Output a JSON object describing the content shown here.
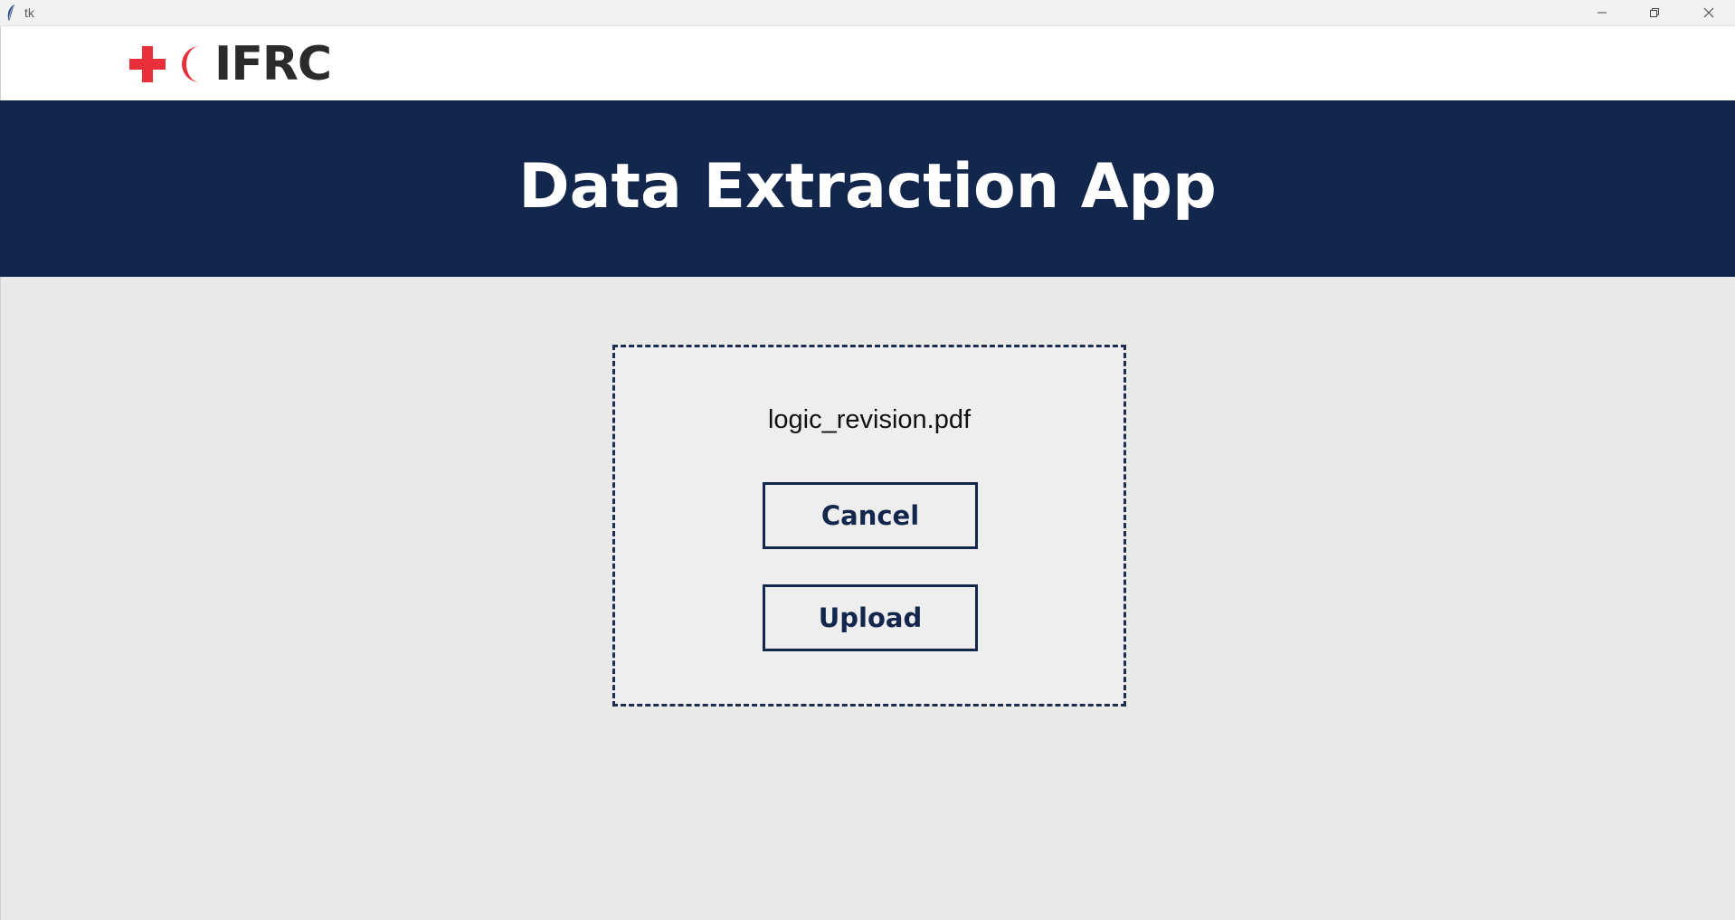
{
  "window": {
    "title": "tk",
    "controls": {
      "minimize": "minimize-icon",
      "restore": "restore-icon",
      "close": "close-icon"
    }
  },
  "logo": {
    "text": "IFRC",
    "cross_color": "#e8303a",
    "crescent_color": "#e8303a"
  },
  "header": {
    "title": "Data Extraction App",
    "background": "#13274d"
  },
  "dropzone": {
    "filename": "logic_revision.pdf",
    "cancel_label": "Cancel",
    "upload_label": "Upload",
    "border_color": "#1b2d50"
  }
}
